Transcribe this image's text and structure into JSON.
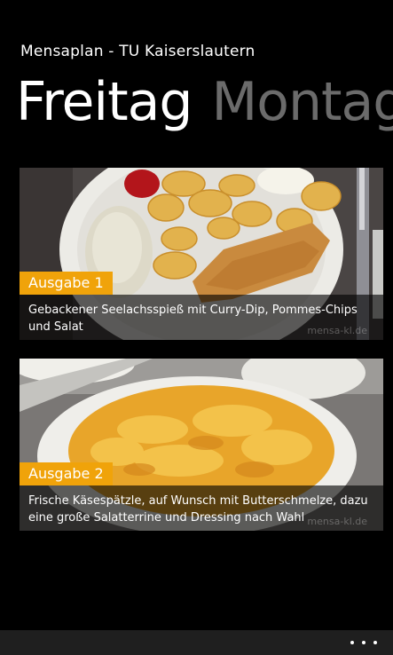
{
  "app": {
    "title": "Mensaplan - TU Kaiserslautern"
  },
  "pivot": {
    "active": "Freitag",
    "next": "Montag"
  },
  "meals": [
    {
      "counter": "Ausgabe 1",
      "description": "Gebackener Seelachsspieß mit Curry-Dip, Pommes-Chips und Salat",
      "watermark": "mensa-kl.de"
    },
    {
      "counter": "Ausgabe 2",
      "description": "Frische Käsespätzle, auf Wunsch mit Butterschmelze, dazu eine große Salatterrine und Dressing nach Wahl",
      "watermark": "mensa-kl.de"
    }
  ],
  "colors": {
    "accent": "#f0a30a",
    "background": "#000000",
    "appbar": "#1f1f1f"
  },
  "appbar": {
    "menu_icon": "ellipsis-icon"
  }
}
